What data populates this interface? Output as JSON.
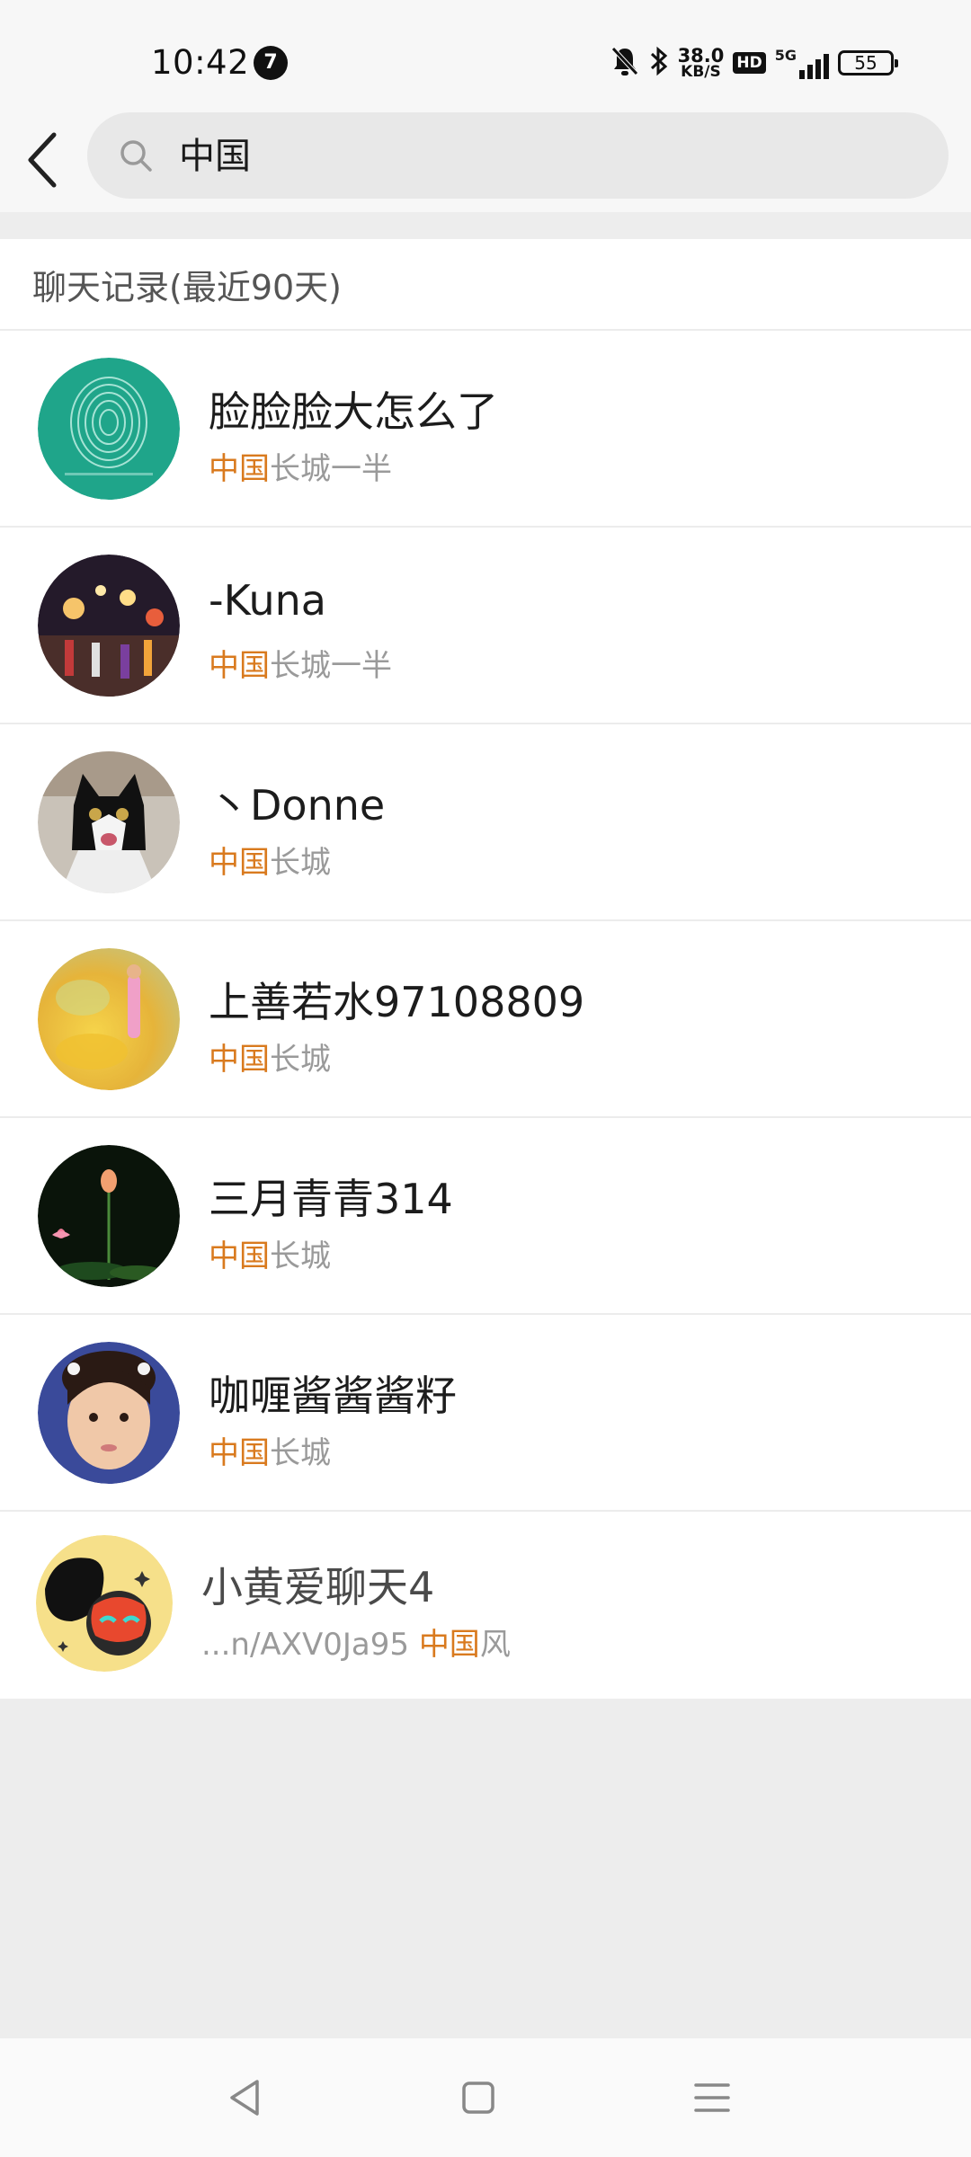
{
  "status_bar": {
    "time": "10:42",
    "notification_count": "7",
    "net_speed_value": "38.0",
    "net_speed_unit": "KB/S",
    "hd_label": "HD",
    "network": "5G",
    "battery": "55"
  },
  "search": {
    "query": "中国"
  },
  "section": {
    "title": "聊天记录(最近90天)"
  },
  "results": [
    {
      "name": "脸脸脸大怎么了",
      "snippet_prefix": "",
      "snippet_highlight": "中国",
      "snippet_rest": "长城一半"
    },
    {
      "name": "-Kuna",
      "snippet_prefix": "",
      "snippet_highlight": "中国",
      "snippet_rest": "长城一半"
    },
    {
      "name": "丶Donne",
      "snippet_prefix": "",
      "snippet_highlight": "中国",
      "snippet_rest": "长城"
    },
    {
      "name": "上善若水97108809",
      "snippet_prefix": "",
      "snippet_highlight": "中国",
      "snippet_rest": "长城"
    },
    {
      "name": "三月青青314",
      "snippet_prefix": "",
      "snippet_highlight": "中国",
      "snippet_rest": "长城"
    },
    {
      "name": "咖喱酱酱酱籽",
      "snippet_prefix": "",
      "snippet_highlight": "中国",
      "snippet_rest": "长城"
    },
    {
      "name": "小黄爱聊天4",
      "snippet_prefix": "...n/AXV0Ja95 ",
      "snippet_highlight": "中国",
      "snippet_rest": "风"
    }
  ],
  "colors": {
    "highlight": "#d97a1e",
    "background": "#ededed"
  }
}
